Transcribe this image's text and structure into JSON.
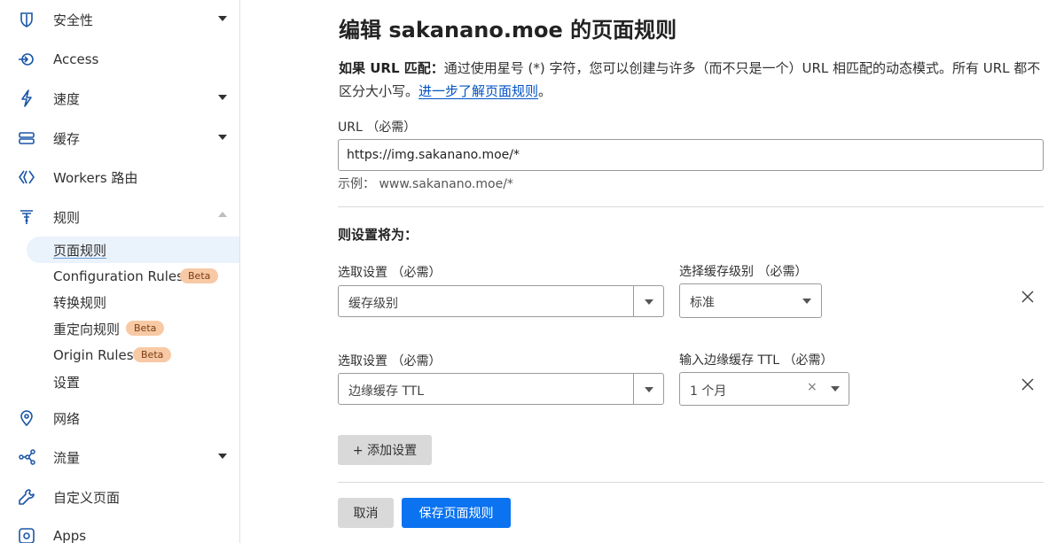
{
  "sidebar": {
    "items": [
      {
        "label": "安全性",
        "icon": "shield-icon"
      },
      {
        "label": "Access",
        "icon": "access-icon"
      },
      {
        "label": "速度",
        "icon": "lightning-icon"
      },
      {
        "label": "缓存",
        "icon": "cache-stack-icon"
      },
      {
        "label": "Workers 路由",
        "icon": "workers-icon"
      },
      {
        "label": "规则",
        "icon": "rules-funnel-icon"
      },
      {
        "label": "网络",
        "icon": "location-pin-icon"
      },
      {
        "label": "流量",
        "icon": "traffic-nodes-icon"
      },
      {
        "label": "自定义页面",
        "icon": "wrench-icon"
      },
      {
        "label": "Apps",
        "icon": "apps-icon"
      }
    ],
    "rules_sub": [
      {
        "label": "页面规则"
      },
      {
        "label": "Configuration Rules",
        "badge": "Beta"
      },
      {
        "label": "转换规则"
      },
      {
        "label": "重定向规则",
        "badge": "Beta"
      },
      {
        "label": "Origin Rules",
        "badge": "Beta"
      },
      {
        "label": "设置"
      }
    ]
  },
  "main": {
    "title": "编辑 sakanano.moe 的页面规则",
    "desc_bold": "如果 URL 匹配：",
    "desc_text": "通过使用星号 (*) 字符，您可以创建与许多（而不只是一个）URL 相匹配的动态模式。所有 URL 都不区分大小写。",
    "desc_link": "进一步了解页面规则",
    "desc_end": "。",
    "url_label": "URL （必需）",
    "url_value": "https://img.sakanano.moe/*",
    "url_hint": "示例：  www.sakanano.moe/*",
    "section_title": "则设置将为：",
    "settings": [
      {
        "select_label": "选取设置 （必需）",
        "select_value": "缓存级别",
        "value_label": "选择缓存级别 （必需）",
        "value": "标准"
      },
      {
        "select_label": "选取设置 （必需）",
        "select_value": "边缘缓存 TTL",
        "value_label": "输入边缘缓存 TTL （必需）",
        "value": "1 个月"
      }
    ],
    "clear_glyph": "×",
    "add_setting": "+ 添加设置",
    "cancel": "取消",
    "save": "保存页面规则"
  }
}
